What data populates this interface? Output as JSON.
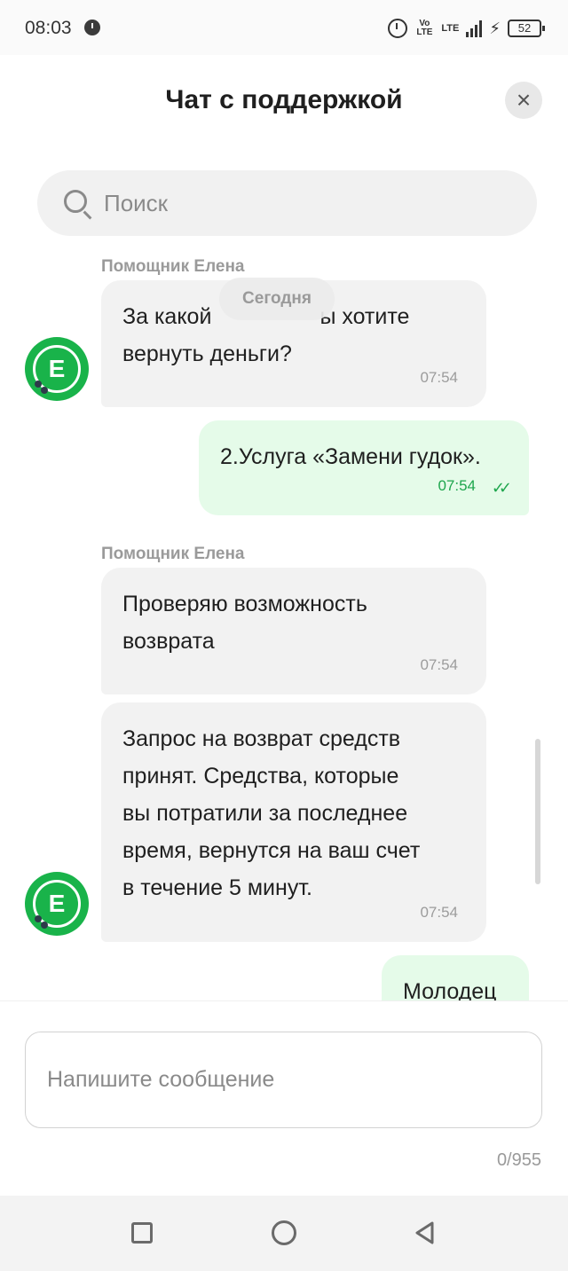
{
  "status_bar": {
    "time": "08:03",
    "volte_top": "Vo",
    "volte_bottom": "LTE",
    "network": "LTE",
    "battery": "52"
  },
  "header": {
    "title": "Чат с поддержкой",
    "close_symbol": "×"
  },
  "search": {
    "placeholder": "Поиск"
  },
  "chat": {
    "date_pill": "Сегодня",
    "messages": [
      {
        "sender": "Помощник Елена",
        "line1": "За какой",
        "line1_end": "ы хотите",
        "line2": "вернуть деньги?",
        "time": "07:54",
        "direction": "in"
      },
      {
        "text": "2.Услуга «Замени гудок».",
        "time": "07:54",
        "direction": "out",
        "status": "read"
      },
      {
        "sender": "Помощник Елена",
        "line1": "Проверяю возможность",
        "line2": "возврата",
        "time": "07:54",
        "direction": "in"
      },
      {
        "line1": "Запрос на возврат средств",
        "line2": "принят. Средства, которые",
        "line3": "вы потратили за последнее",
        "line4": "время, вернутся на ваш счет",
        "line5": "в течение 5 минут.",
        "time": "07:54",
        "direction": "in"
      },
      {
        "text": "Молодец",
        "direction": "out"
      }
    ],
    "avatar_letter": "E"
  },
  "composer": {
    "placeholder": "Напишите сообщение",
    "char_count": "0/955"
  },
  "icons": {
    "close": "close-icon",
    "search": "search-icon",
    "alarm": "alarm-icon",
    "read_receipt": "double-check-icon",
    "nav_recents": "square-icon",
    "nav_home": "circle-icon",
    "nav_back": "triangle-back-icon"
  },
  "colors": {
    "accent": "#19b34a",
    "outgoing_bubble": "#e5fbe9",
    "incoming_bubble": "#f2f2f2",
    "read_receipt": "#1ea64d"
  }
}
